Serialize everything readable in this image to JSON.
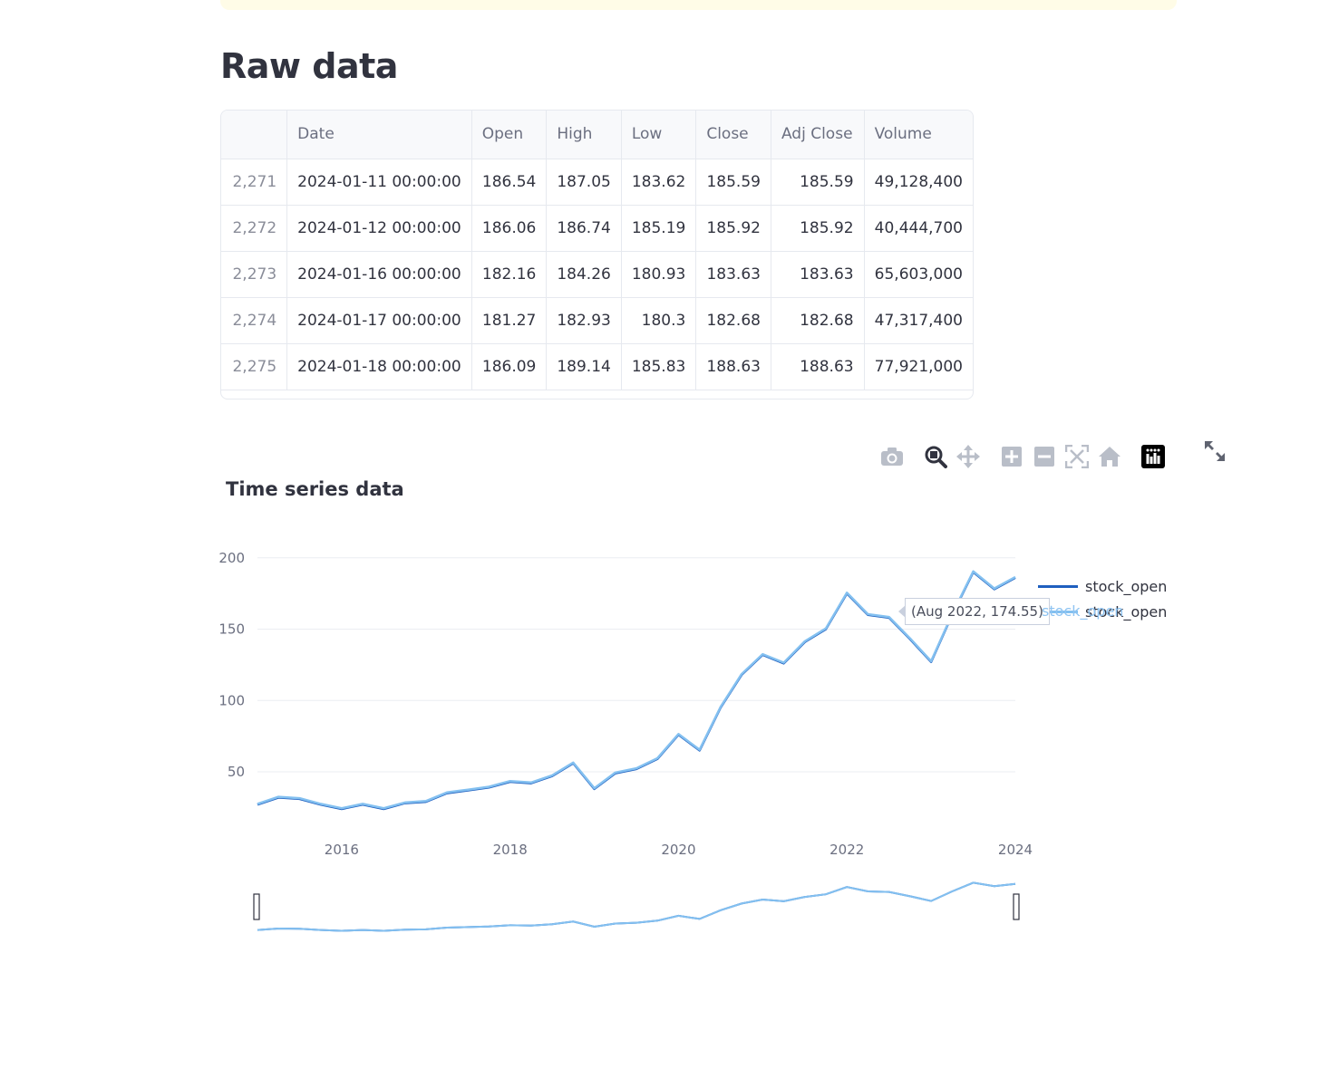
{
  "page": {
    "title": "Raw data"
  },
  "table": {
    "columns": [
      "",
      "Date",
      "Open",
      "High",
      "Low",
      "Close",
      "Adj Close",
      "Volume"
    ],
    "rows": [
      {
        "idx": "2,271",
        "date": "2024-01-11 00:00:00",
        "open": "186.54",
        "high": "187.05",
        "low": "183.62",
        "close": "185.59",
        "adj_close": "185.59",
        "volume": "49,128,400"
      },
      {
        "idx": "2,272",
        "date": "2024-01-12 00:00:00",
        "open": "186.06",
        "high": "186.74",
        "low": "185.19",
        "close": "185.92",
        "adj_close": "185.92",
        "volume": "40,444,700"
      },
      {
        "idx": "2,273",
        "date": "2024-01-16 00:00:00",
        "open": "182.16",
        "high": "184.26",
        "low": "180.93",
        "close": "183.63",
        "adj_close": "183.63",
        "volume": "65,603,000"
      },
      {
        "idx": "2,274",
        "date": "2024-01-17 00:00:00",
        "open": "181.27",
        "high": "182.93",
        "low": "180.3",
        "close": "182.68",
        "adj_close": "182.68",
        "volume": "47,317,400"
      },
      {
        "idx": "2,275",
        "date": "2024-01-18 00:00:00",
        "open": "186.09",
        "high": "189.14",
        "low": "185.83",
        "close": "188.63",
        "adj_close": "188.63",
        "volume": "77,921,000"
      }
    ]
  },
  "toolbar": {
    "icons": [
      "camera-icon",
      "zoom-icon",
      "pan-icon",
      "zoom-in-icon",
      "zoom-out-icon",
      "autoscale-icon",
      "reset-axes-icon",
      "plotly-logo-icon"
    ],
    "fullscreen_icon": "expand-icon"
  },
  "hover": {
    "text": "(Aug 2022, 174.55)",
    "label": "stock_open"
  },
  "chart_data": {
    "type": "line",
    "title": "Time series data",
    "xlabel": "",
    "ylabel": "",
    "x_ticks": [
      "2016",
      "2018",
      "2020",
      "2022",
      "2024"
    ],
    "y_ticks": [
      50,
      100,
      150,
      200
    ],
    "xlim": [
      "2015-01",
      "2024-01"
    ],
    "ylim": [
      10,
      210
    ],
    "grid": true,
    "legend_position": "top-right",
    "rangeslider": true,
    "x": [
      "2015-01",
      "2015-04",
      "2015-07",
      "2015-10",
      "2016-01",
      "2016-04",
      "2016-07",
      "2016-10",
      "2017-01",
      "2017-04",
      "2017-07",
      "2017-10",
      "2018-01",
      "2018-04",
      "2018-07",
      "2018-10",
      "2019-01",
      "2019-04",
      "2019-07",
      "2019-10",
      "2020-01",
      "2020-04",
      "2020-07",
      "2020-10",
      "2021-01",
      "2021-04",
      "2021-07",
      "2021-10",
      "2022-01",
      "2022-04",
      "2022-07",
      "2022-10",
      "2023-01",
      "2023-04",
      "2023-07",
      "2023-10",
      "2024-01"
    ],
    "series": [
      {
        "name": "stock_open",
        "color": "#1f5fbf",
        "values": [
          27,
          32,
          31,
          27,
          24,
          27,
          24,
          28,
          29,
          35,
          37,
          39,
          43,
          42,
          47,
          56,
          38,
          49,
          52,
          59,
          76,
          65,
          95,
          118,
          132,
          126,
          141,
          150,
          175,
          160,
          158,
          143,
          127,
          160,
          190,
          178,
          186
        ]
      },
      {
        "name": "stock_open",
        "color": "#83c0f0",
        "values": [
          27,
          32,
          31,
          27,
          24,
          27,
          24,
          28,
          29,
          35,
          37,
          39,
          43,
          42,
          47,
          56,
          38,
          49,
          52,
          59,
          76,
          65,
          95,
          118,
          132,
          126,
          141,
          150,
          175,
          160,
          158,
          143,
          127,
          160,
          190,
          178,
          186
        ]
      }
    ],
    "colors": {
      "series1": "#1f5fbf",
      "series2": "#83c0f0",
      "grid": "#ebedf2",
      "axis_text": "#6b6f80"
    }
  }
}
